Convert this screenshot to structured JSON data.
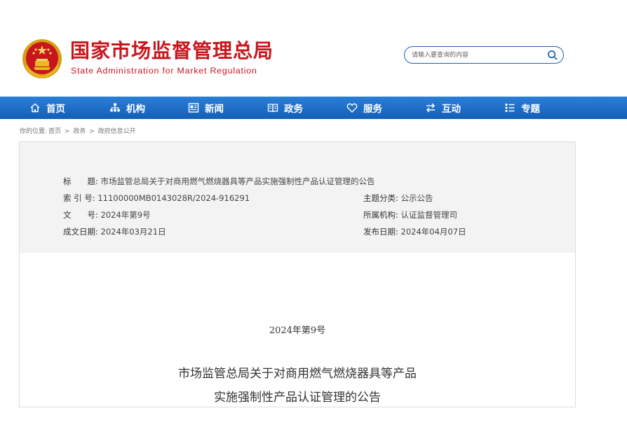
{
  "header": {
    "title_cn": "国家市场监督管理总局",
    "title_en": "State Administration for Market Regulation",
    "emblem_icon": "national-emblem-icon",
    "brand_color": "#c8161d"
  },
  "search": {
    "placeholder": "请输入要查询的内容",
    "icon": "search-icon"
  },
  "nav": {
    "bar_color": "#1a6cc6",
    "items": [
      {
        "label": "首页",
        "icon": "home-icon"
      },
      {
        "label": "机构",
        "icon": "org-chart-icon"
      },
      {
        "label": "新闻",
        "icon": "news-icon"
      },
      {
        "label": "政务",
        "icon": "government-affairs-icon"
      },
      {
        "label": "服务",
        "icon": "heart-icon"
      },
      {
        "label": "互动",
        "icon": "exchange-arrows-icon"
      },
      {
        "label": "专题",
        "icon": "topic-list-icon"
      }
    ]
  },
  "breadcrumb": {
    "prefix": "你的位置:",
    "items": [
      "首页",
      "政务",
      "政府信息公开"
    ],
    "separator": ">"
  },
  "meta": {
    "title_label": "标　　题:",
    "title_value": "市场监管总局关于对商用燃气燃烧器具等产品实施强制性产品认证管理的公告",
    "index_label": "索 引 号:",
    "index_value": "11100000MB0143028R/2024-916291",
    "topic_label": "主题分类:",
    "topic_value": "公示公告",
    "docno_label": "文　　号:",
    "docno_value": "2024年第9号",
    "org_label": "所属机构:",
    "org_value": "认证监督管理司",
    "date_label": "成文日期:",
    "date_value": "2024年03月21日",
    "pub_label": "发布日期:",
    "pub_value": "2024年04月07日"
  },
  "document": {
    "number": "2024年第9号",
    "title_line1": "市场监管总局关于对商用燃气燃烧器具等产品",
    "title_line2": "实施强制性产品认证管理的公告"
  }
}
